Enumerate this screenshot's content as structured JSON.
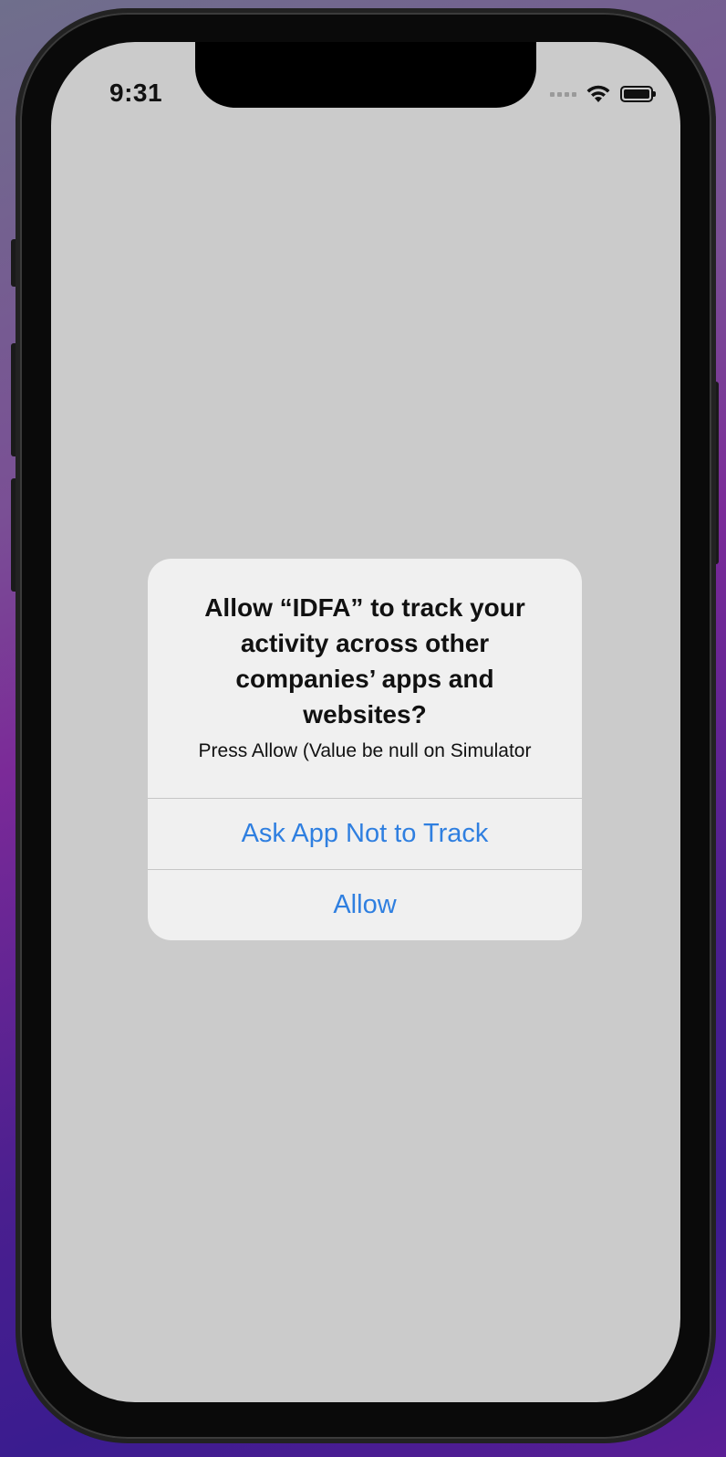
{
  "status_bar": {
    "time": "9:31"
  },
  "alert": {
    "title": "Allow “IDFA” to track your activity across other companies’ apps and websites?",
    "message": "Press Allow (Value be null on Simulator",
    "buttons": [
      {
        "label": "Ask App Not to Track"
      },
      {
        "label": "Allow"
      }
    ]
  },
  "colors": {
    "accent": "#2f7fe0",
    "screen_background": "#cbcbcb",
    "alert_background": "#f0f0f0"
  },
  "icons": [
    "signal-icon",
    "wifi-icon",
    "battery-icon"
  ]
}
